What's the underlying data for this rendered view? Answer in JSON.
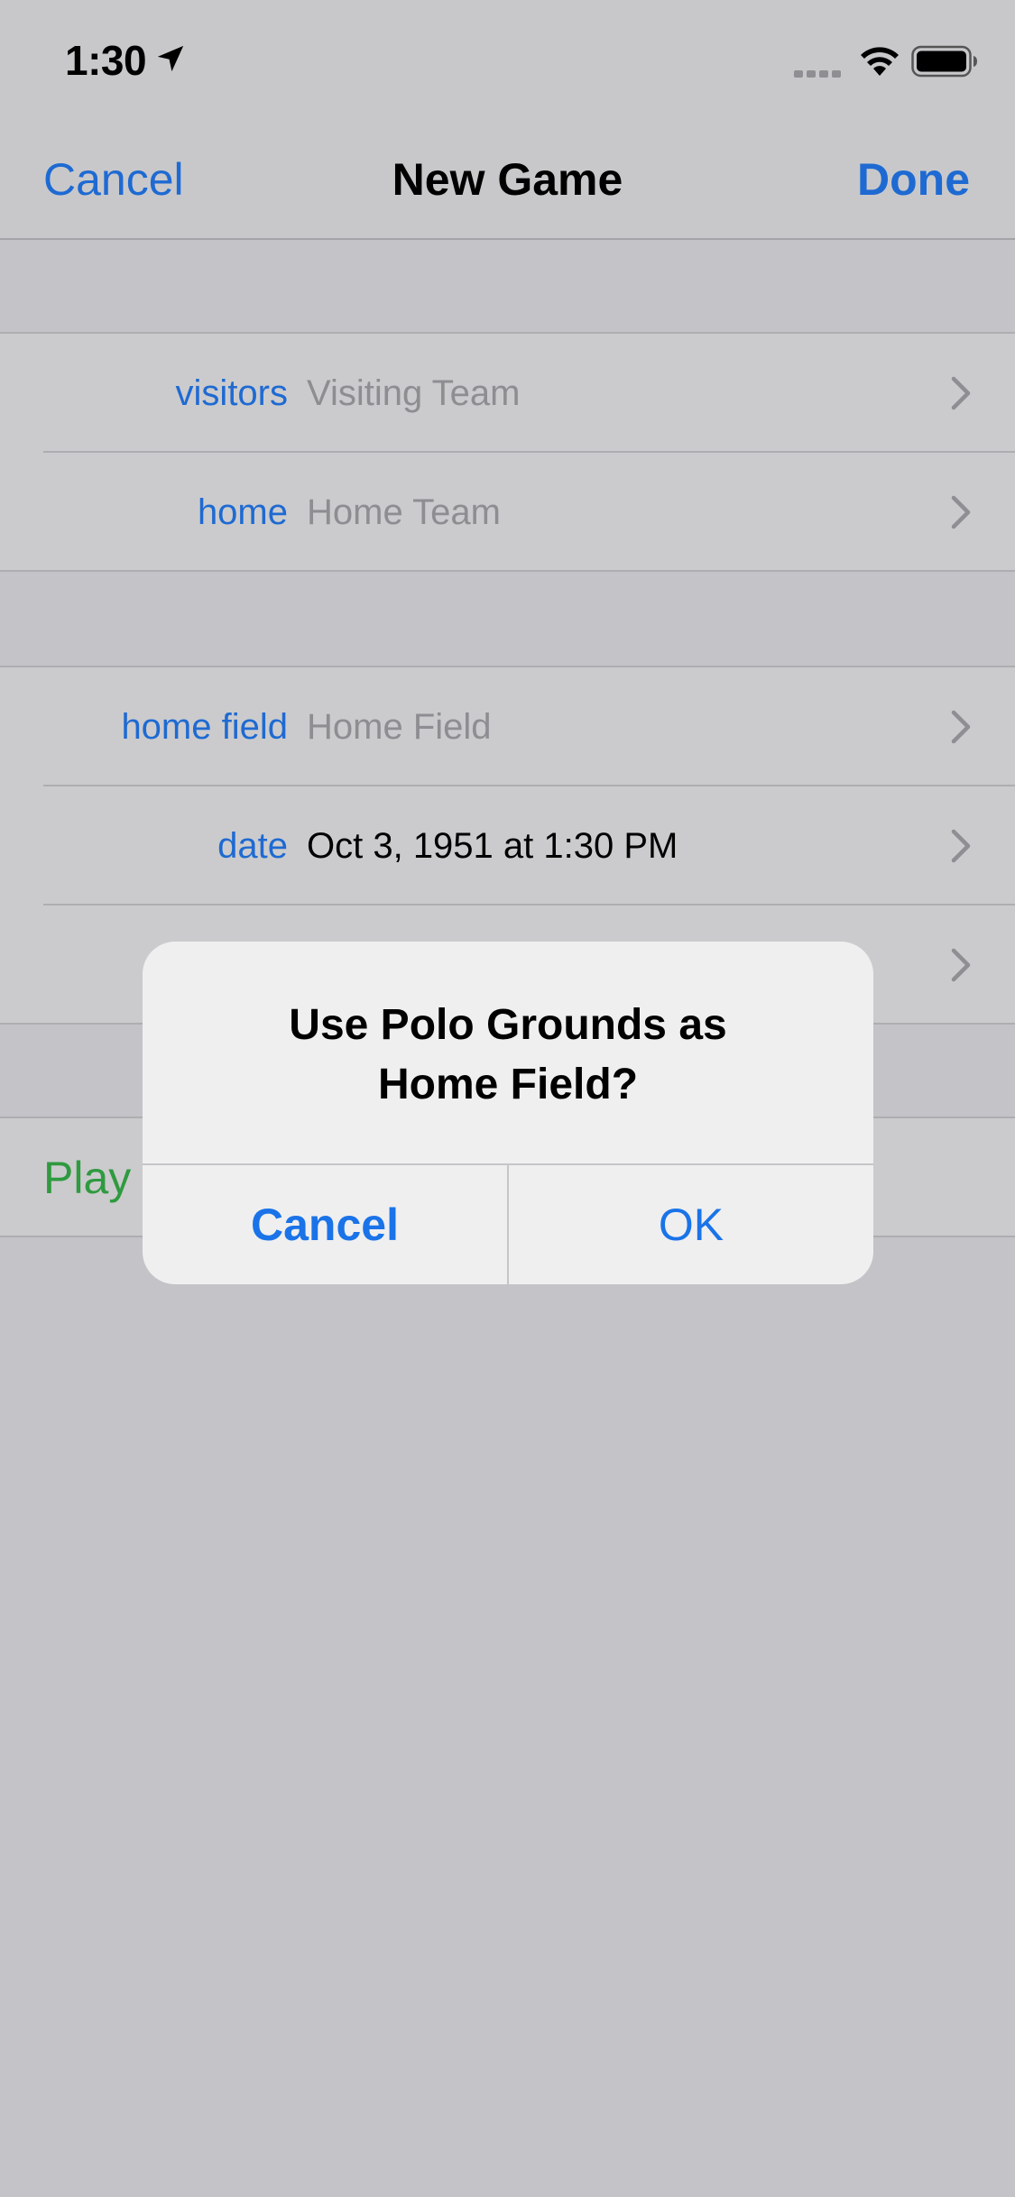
{
  "status": {
    "time": "1:30"
  },
  "nav": {
    "cancel_label": "Cancel",
    "title": "New Game",
    "done_label": "Done"
  },
  "teams": {
    "visitors_label": "visitors",
    "visitors_placeholder": "Visiting Team",
    "home_label": "home",
    "home_placeholder": "Home Team"
  },
  "details": {
    "home_field_label": "home field",
    "home_field_placeholder": "Home Field",
    "date_label": "date",
    "date_value": "Oct 3, 1951 at 1:30 PM"
  },
  "actions": {
    "play_label": "Play"
  },
  "alert": {
    "title_line1": "Use Polo Grounds as",
    "title_line2": "Home Field?",
    "cancel_label": "Cancel",
    "ok_label": "OK"
  },
  "colors": {
    "accent": "#1e6ad2",
    "play": "#2f9a3f",
    "placeholder": "#8d8d92"
  }
}
